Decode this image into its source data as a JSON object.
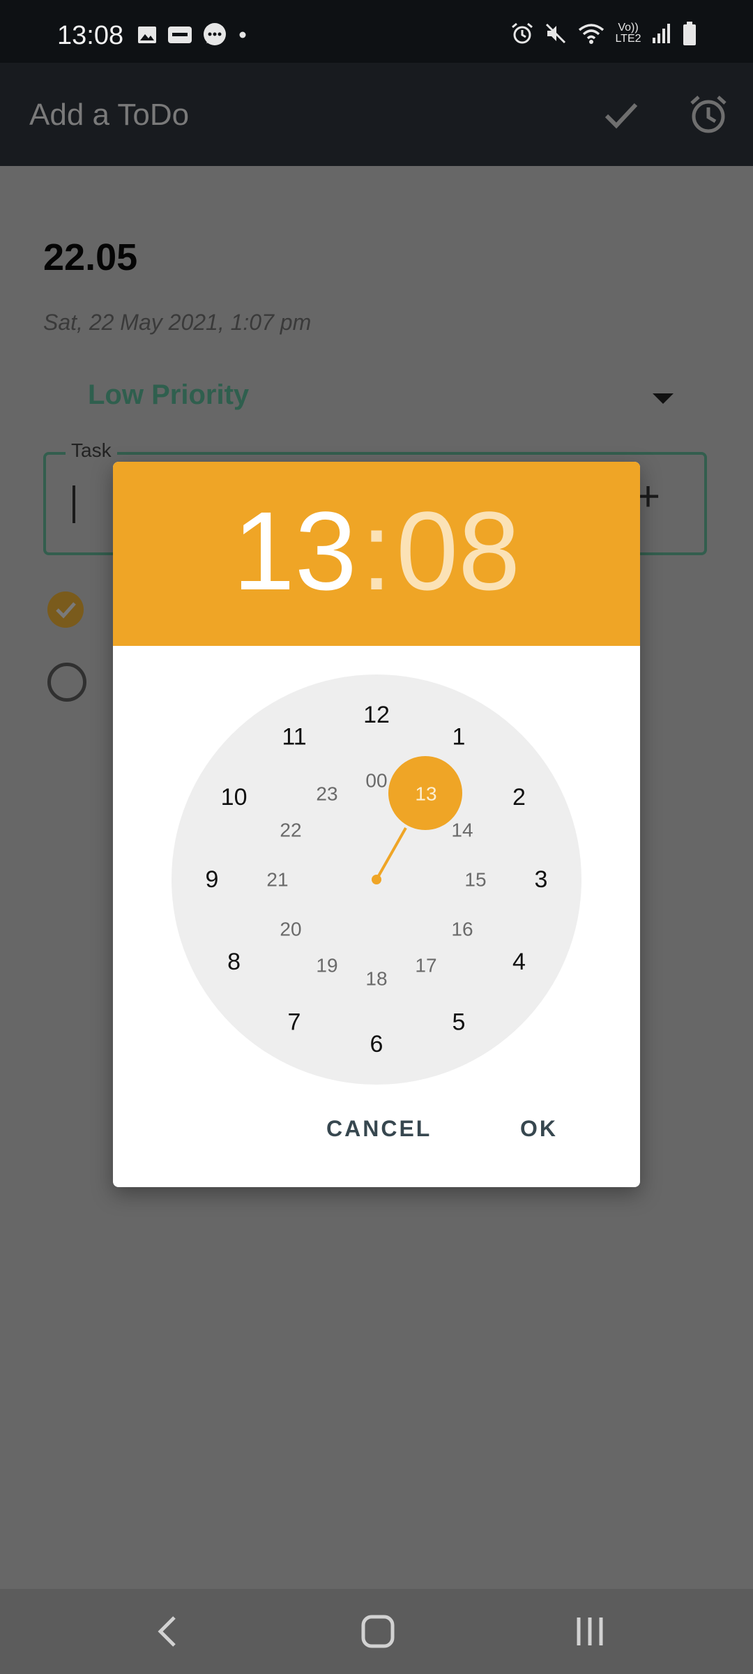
{
  "status_bar": {
    "time": "13:08",
    "network_label": "Vo)) LTE2"
  },
  "app_bar": {
    "title": "Add a ToDo",
    "icons": [
      "check-icon",
      "alarm-icon"
    ]
  },
  "form": {
    "date_title": "22.05",
    "date_subtitle": "Sat, 22 May 2021, 1:07 pm",
    "priority_selected": "Low Priority",
    "task_label": "Task",
    "task_value": "",
    "add_symbol": "+"
  },
  "time_picker": {
    "hour": "13",
    "separator": ":",
    "minute": "08",
    "selected_hour": "13",
    "outer_hours": [
      "12",
      "1",
      "2",
      "3",
      "4",
      "5",
      "6",
      "7",
      "8",
      "9",
      "10",
      "11"
    ],
    "inner_hours": [
      "00",
      "13",
      "14",
      "15",
      "16",
      "17",
      "18",
      "19",
      "20",
      "21",
      "22",
      "23"
    ],
    "cancel_label": "CANCEL",
    "ok_label": "OK"
  },
  "colors": {
    "accent": "#efa526",
    "dialog_button": "#37474f",
    "clock_face": "#eeeeee",
    "priority_text": "#2f5f4e"
  }
}
